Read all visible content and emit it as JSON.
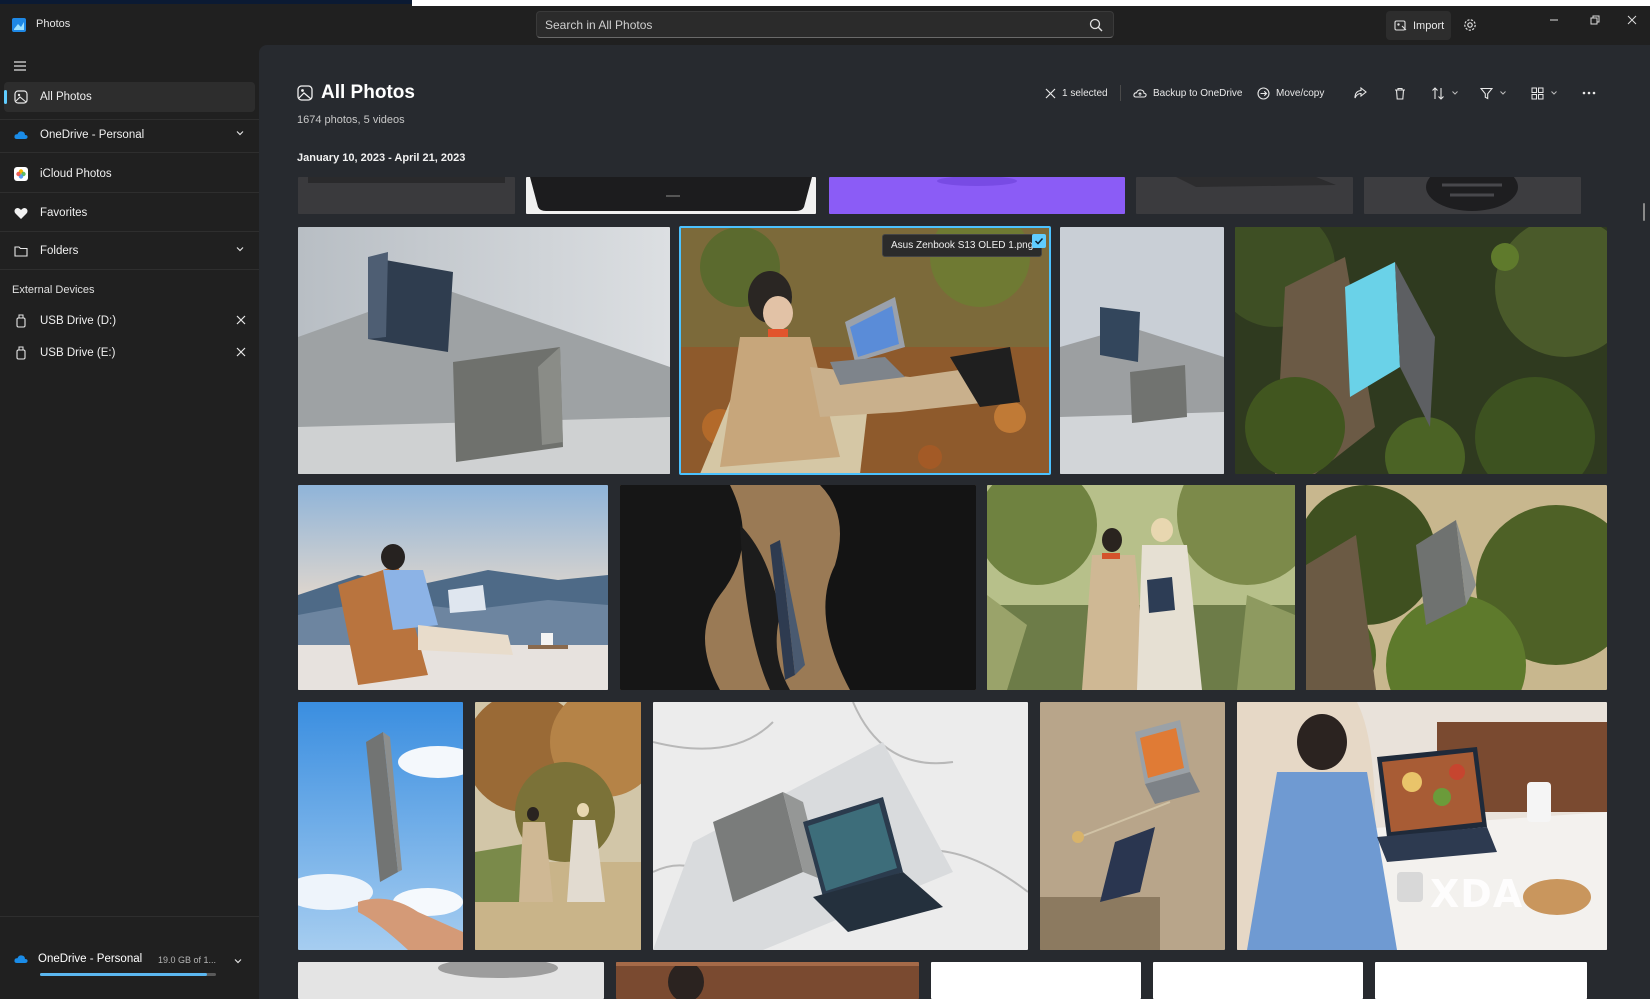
{
  "titlebar": {
    "app_name": "Photos",
    "search_placeholder": "Search in All Photos",
    "import_label": "Import"
  },
  "sidebar": {
    "items": [
      {
        "label": "All Photos",
        "icon": "photos-icon",
        "selected": true
      },
      {
        "label": "OneDrive - Personal",
        "icon": "onedrive-cloud-icon",
        "expandable": true
      },
      {
        "label": "iCloud Photos",
        "icon": "icloud-photos-icon"
      },
      {
        "label": "Favorites",
        "icon": "heart-icon"
      },
      {
        "label": "Folders",
        "icon": "folder-icon",
        "expandable": true
      }
    ],
    "external_devices_label": "External Devices",
    "devices": [
      {
        "label": "USB Drive (D:)",
        "icon": "usb-drive-icon"
      },
      {
        "label": "USB Drive (E:)",
        "icon": "usb-drive-icon"
      }
    ],
    "storage": {
      "label": "OneDrive - Personal",
      "quota_text": "19.0 GB of 1...",
      "used_fraction": 0.95
    }
  },
  "main": {
    "title": "All Photos",
    "subtitle": "1674 photos, 5 videos",
    "date_range": "January 10, 2023 - April 21, 2023",
    "toolbar": {
      "selected_label": "1 selected",
      "backup_label": "Backup to OneDrive",
      "move_label": "Move/copy"
    },
    "tooltip": "Asus Zenbook S13 OLED 1.png",
    "watermark": "XDA"
  },
  "colors": {
    "accent": "#60cdff",
    "selection_outline": "#4cc2ff",
    "content_bg": "#272a2f",
    "sidebar_bg": "#202020"
  }
}
